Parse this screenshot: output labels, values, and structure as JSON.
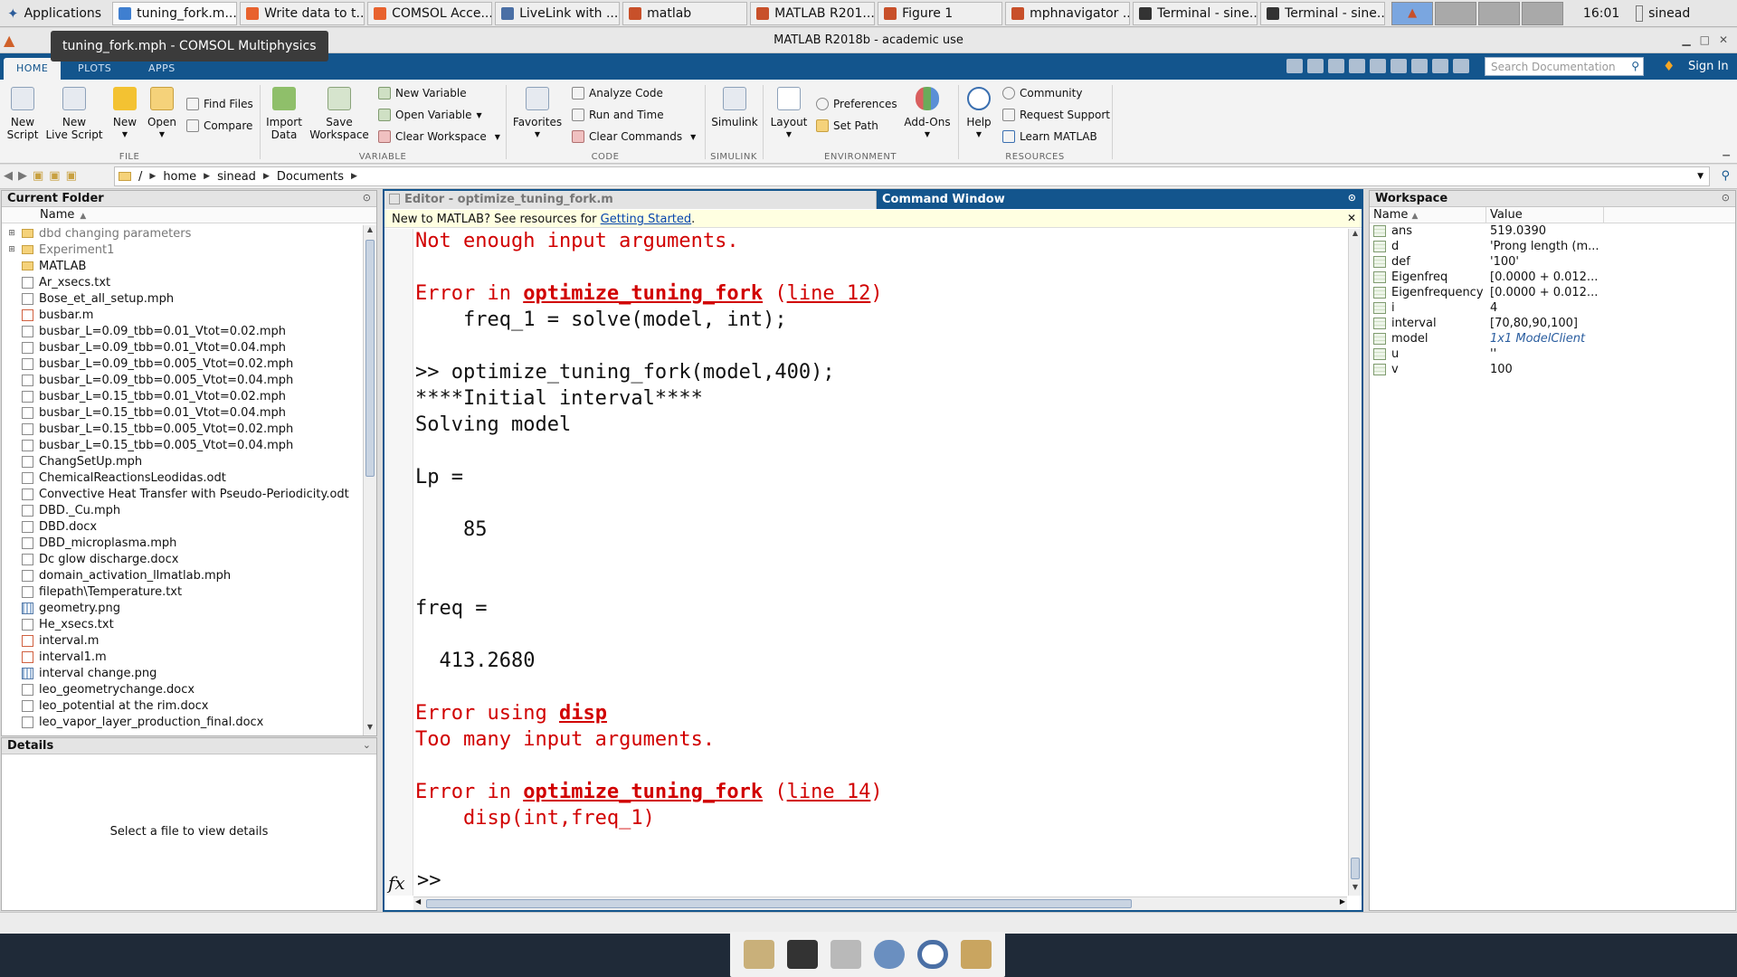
{
  "taskbar": {
    "apps_label": "Applications",
    "tasks": [
      {
        "label": "tuning_fork.m...",
        "icon": "comsol-icon",
        "color": "#3f7fd0"
      },
      {
        "label": "Write data to t...",
        "icon": "firefox-icon",
        "color": "#e8622e"
      },
      {
        "label": "COMSOL Acce...",
        "icon": "firefox-icon",
        "color": "#e8622e"
      },
      {
        "label": "LiveLink with ...",
        "icon": "document-icon",
        "color": "#4a6fa5"
      },
      {
        "label": "matlab",
        "icon": "matlab-icon",
        "color": "#c8502a"
      },
      {
        "label": "MATLAB R201...",
        "icon": "matlab-icon",
        "color": "#c8502a"
      },
      {
        "label": "Figure 1",
        "icon": "figure-icon",
        "color": "#c8502a"
      },
      {
        "label": "mphnavigator ...",
        "icon": "matlab-icon",
        "color": "#c8502a"
      },
      {
        "label": "Terminal - sine...",
        "icon": "terminal-icon",
        "color": "#333333"
      },
      {
        "label": "Terminal - sine...",
        "icon": "terminal-icon",
        "color": "#333333"
      }
    ],
    "clock": "16:01",
    "user": "sinead"
  },
  "tooltip": "tuning_fork.mph - COMSOL Multiphysics",
  "window_title": "MATLAB R2018b - academic use",
  "ribbon": {
    "tabs": [
      "HOME",
      "PLOTS",
      "APPS"
    ],
    "search_placeholder": "Search Documentation",
    "sign_in": "Sign In",
    "file": {
      "new_script": [
        "New",
        "Script"
      ],
      "new_live_script": [
        "New",
        "Live Script"
      ],
      "new": "New",
      "open": "Open",
      "find_files": "Find Files",
      "compare": "Compare",
      "label": "FILE"
    },
    "variable": {
      "import_data": [
        "Import",
        "Data"
      ],
      "save_workspace": [
        "Save",
        "Workspace"
      ],
      "new_variable": "New Variable",
      "open_variable": "Open Variable",
      "clear_workspace": "Clear Workspace",
      "label": "VARIABLE"
    },
    "code": {
      "favorites": "Favorites",
      "analyze_code": "Analyze Code",
      "run_and_time": "Run and Time",
      "clear_commands": "Clear Commands",
      "label": "CODE"
    },
    "simulink": {
      "simulink": "Simulink",
      "label": "SIMULINK"
    },
    "environment": {
      "layout": "Layout",
      "preferences": "Preferences",
      "set_path": "Set Path",
      "add_ons": "Add-Ons",
      "label": "ENVIRONMENT"
    },
    "resources": {
      "help": "Help",
      "community": "Community",
      "request_support": "Request Support",
      "learn_matlab": "Learn MATLAB",
      "label": "RESOURCES"
    }
  },
  "address": {
    "root": "/",
    "crumbs": [
      "home",
      "sinead",
      "Documents"
    ]
  },
  "current_folder": {
    "title": "Current Folder",
    "column": "Name",
    "items": [
      {
        "name": "dbd changing parameters",
        "type": "folder",
        "expandable": true,
        "dim": true
      },
      {
        "name": "Experiment1",
        "type": "folder",
        "expandable": true,
        "dim": true
      },
      {
        "name": "MATLAB",
        "type": "folder",
        "expandable": false,
        "dim": false
      },
      {
        "name": "Ar_xsecs.txt",
        "type": "file"
      },
      {
        "name": "Bose_et_all_setup.mph",
        "type": "file"
      },
      {
        "name": "busbar.m",
        "type": "mfile"
      },
      {
        "name": "busbar_L=0.09_tbb=0.01_Vtot=0.02.mph",
        "type": "file"
      },
      {
        "name": "busbar_L=0.09_tbb=0.01_Vtot=0.04.mph",
        "type": "file"
      },
      {
        "name": "busbar_L=0.09_tbb=0.005_Vtot=0.02.mph",
        "type": "file"
      },
      {
        "name": "busbar_L=0.09_tbb=0.005_Vtot=0.04.mph",
        "type": "file"
      },
      {
        "name": "busbar_L=0.15_tbb=0.01_Vtot=0.02.mph",
        "type": "file"
      },
      {
        "name": "busbar_L=0.15_tbb=0.01_Vtot=0.04.mph",
        "type": "file"
      },
      {
        "name": "busbar_L=0.15_tbb=0.005_Vtot=0.02.mph",
        "type": "file"
      },
      {
        "name": "busbar_L=0.15_tbb=0.005_Vtot=0.04.mph",
        "type": "file"
      },
      {
        "name": "ChangSetUp.mph",
        "type": "file"
      },
      {
        "name": "ChemicalReactionsLeodidas.odt",
        "type": "file"
      },
      {
        "name": "Convective Heat Transfer with Pseudo-Periodicity.odt",
        "type": "file"
      },
      {
        "name": "DBD._Cu.mph",
        "type": "file"
      },
      {
        "name": "DBD.docx",
        "type": "file"
      },
      {
        "name": "DBD_microplasma.mph",
        "type": "file"
      },
      {
        "name": "Dc glow discharge.docx",
        "type": "file"
      },
      {
        "name": "domain_activation_llmatlab.mph",
        "type": "file"
      },
      {
        "name": "filepath\\Temperature.txt",
        "type": "file"
      },
      {
        "name": "geometry.png",
        "type": "img"
      },
      {
        "name": "He_xsecs.txt",
        "type": "file"
      },
      {
        "name": "interval.m",
        "type": "mfile"
      },
      {
        "name": "interval1.m",
        "type": "mfile"
      },
      {
        "name": "interval change.png",
        "type": "img"
      },
      {
        "name": "leo_geometrychange.docx",
        "type": "file"
      },
      {
        "name": "leo_potential at the rim.docx",
        "type": "file"
      },
      {
        "name": "leo_vapor_layer_production_final.docx",
        "type": "file"
      }
    ]
  },
  "details": {
    "title": "Details",
    "message": "Select a file to view details"
  },
  "editor_tab": "Editor - optimize_tuning_fork.m",
  "command_window": {
    "title": "Command Window",
    "banner_text": "New to MATLAB? See resources for ",
    "banner_link": "Getting Started",
    "banner_end": ".",
    "prompt": ">>",
    "fx": "fx"
  },
  "cw_lines": [
    {
      "kind": "err",
      "text": "Not enough input arguments."
    },
    {
      "kind": "blank"
    },
    {
      "kind": "errloc",
      "pre": "Error in ",
      "fn": "optimize_tuning_fork",
      "mid": " (",
      "line": "line 12",
      "post": ")"
    },
    {
      "kind": "plain",
      "text": "    freq_1 = solve(model, int);"
    },
    {
      "kind": "blank"
    },
    {
      "kind": "plain",
      "text": ">> optimize_tuning_fork(model,400);"
    },
    {
      "kind": "plain",
      "text": "****Initial interval****"
    },
    {
      "kind": "plain",
      "text": "Solving model"
    },
    {
      "kind": "blank"
    },
    {
      "kind": "plain",
      "text": "Lp ="
    },
    {
      "kind": "blank"
    },
    {
      "kind": "plain",
      "text": "    85"
    },
    {
      "kind": "blank"
    },
    {
      "kind": "blank"
    },
    {
      "kind": "plain",
      "text": "freq ="
    },
    {
      "kind": "blank"
    },
    {
      "kind": "plain",
      "text": "  413.2680"
    },
    {
      "kind": "blank"
    },
    {
      "kind": "errfn",
      "pre": "Error using ",
      "fn": "disp"
    },
    {
      "kind": "err",
      "text": "Too many input arguments."
    },
    {
      "kind": "blank"
    },
    {
      "kind": "errloc",
      "pre": "Error in ",
      "fn": "optimize_tuning_fork",
      "mid": " (",
      "line": "line 14",
      "post": ")"
    },
    {
      "kind": "err",
      "text": "    disp(int,freq_1)"
    }
  ],
  "workspace": {
    "title": "Workspace",
    "col_name": "Name",
    "col_value": "Value",
    "vars": [
      {
        "name": "ans",
        "value": "519.0390"
      },
      {
        "name": "d",
        "value": "'Prong length (m..."
      },
      {
        "name": "def",
        "value": "'100'"
      },
      {
        "name": "Eigenfreq",
        "value": "[0.0000 + 0.012..."
      },
      {
        "name": "Eigenfrequency",
        "value": "[0.0000 + 0.012..."
      },
      {
        "name": "i",
        "value": "4"
      },
      {
        "name": "interval",
        "value": "[70,80,90,100]"
      },
      {
        "name": "model",
        "value": "1x1 ModelClient",
        "obj": true
      },
      {
        "name": "u",
        "value": "''"
      },
      {
        "name": "v",
        "value": "100"
      }
    ]
  },
  "colors": {
    "matlab_blue": "#13558d",
    "error_red": "#d10000",
    "link_blue": "#0645ad"
  }
}
